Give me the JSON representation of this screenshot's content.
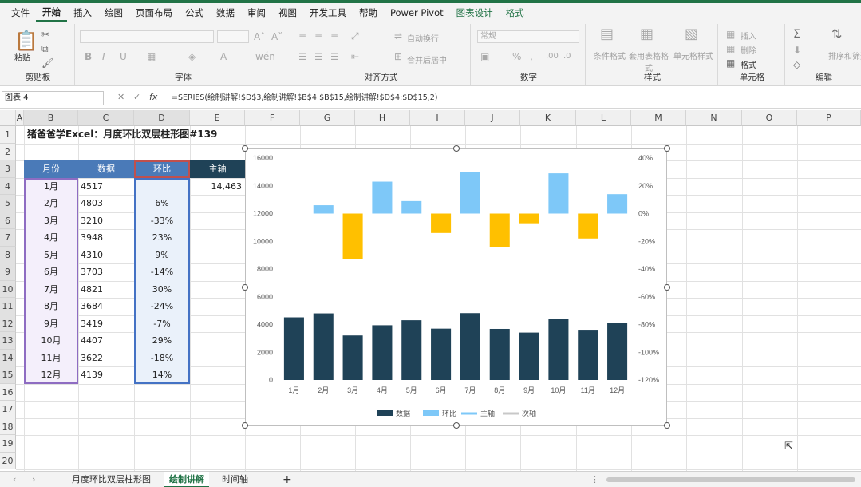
{
  "menu": [
    "文件",
    "开始",
    "插入",
    "绘图",
    "页面布局",
    "公式",
    "数据",
    "审阅",
    "视图",
    "开发工具",
    "帮助",
    "Power Pivot",
    "图表设计",
    "格式"
  ],
  "ribbon": {
    "clipboard": {
      "label": "剪贴板",
      "paste": "粘贴"
    },
    "font": {
      "label": "字体",
      "bold": "B",
      "italic": "I",
      "underline": "U"
    },
    "alignment": {
      "label": "对齐方式",
      "wrap": "自动换行",
      "merge": "合并后居中"
    },
    "number": {
      "label": "数字",
      "format": "常规"
    },
    "styles": {
      "label": "样式",
      "conditional": "条件格式",
      "table": "套用表格格式",
      "cellstyle": "单元格样式"
    },
    "cells": {
      "label": "单元格",
      "insert": "插入",
      "delete": "删除",
      "format": "格式"
    },
    "editing": {
      "label": "编辑",
      "sort": "排序和筛选"
    }
  },
  "formula_bar": {
    "name_box": "图表 4",
    "formula": "=SERIES(绘制讲解!$D$3,绘制讲解!$B$4:$B$15,绘制讲解!$D$4:$D$15,2)"
  },
  "columns": [
    "A",
    "B",
    "C",
    "D",
    "E",
    "F",
    "G",
    "H",
    "I",
    "J",
    "K",
    "L",
    "M",
    "N",
    "O",
    "P"
  ],
  "rows": [
    "1",
    "2",
    "3",
    "4",
    "5",
    "6",
    "7",
    "8",
    "9",
    "10",
    "11",
    "12",
    "13",
    "14",
    "15",
    "16",
    "17",
    "18",
    "19",
    "20"
  ],
  "sheet": {
    "title": "猪爸爸学Excel：月度环比双层柱形图#139",
    "headers": {
      "month": "月份",
      "data": "数据",
      "mom": "环比",
      "main_axis": "主轴"
    },
    "main_axis_value": "14,463",
    "table": [
      {
        "month": "1月",
        "data": "4517",
        "mom": ""
      },
      {
        "month": "2月",
        "data": "4803",
        "mom": "6%"
      },
      {
        "month": "3月",
        "data": "3210",
        "mom": "-33%"
      },
      {
        "month": "4月",
        "data": "3948",
        "mom": "23%"
      },
      {
        "month": "5月",
        "data": "4310",
        "mom": "9%"
      },
      {
        "month": "6月",
        "data": "3703",
        "mom": "-14%"
      },
      {
        "month": "7月",
        "data": "4821",
        "mom": "30%"
      },
      {
        "month": "8月",
        "data": "3684",
        "mom": "-24%"
      },
      {
        "month": "9月",
        "data": "3419",
        "mom": "-7%"
      },
      {
        "month": "10月",
        "data": "4407",
        "mom": "29%"
      },
      {
        "month": "11月",
        "data": "3622",
        "mom": "-18%"
      },
      {
        "month": "12月",
        "data": "4139",
        "mom": "14%"
      }
    ]
  },
  "chart_data": {
    "type": "bar",
    "categories": [
      "1月",
      "2月",
      "3月",
      "4月",
      "5月",
      "6月",
      "7月",
      "8月",
      "9月",
      "10月",
      "11月",
      "12月"
    ],
    "series": [
      {
        "name": "数据",
        "axis": "primary",
        "values": [
          4517,
          4803,
          3210,
          3948,
          4310,
          3703,
          4821,
          3684,
          3419,
          4407,
          3622,
          4139
        ]
      },
      {
        "name": "环比",
        "axis": "secondary",
        "values": [
          null,
          6,
          -33,
          23,
          9,
          -14,
          30,
          -24,
          -7,
          29,
          -18,
          14
        ]
      }
    ],
    "primary_ylim": [
      0,
      16000
    ],
    "primary_ticks": [
      "0",
      "2000",
      "4000",
      "6000",
      "8000",
      "10000",
      "12000",
      "14000",
      "16000"
    ],
    "secondary_ylim": [
      -120,
      40
    ],
    "secondary_ticks": [
      "40%",
      "20%",
      "0%",
      "-20%",
      "-40%",
      "-60%",
      "-80%",
      "-100%",
      "-120%"
    ],
    "legend": [
      "数据",
      "环比",
      "主轴",
      "次轴"
    ],
    "legend_position": "bottom",
    "colors": {
      "data": "#1f4257",
      "mom_pos": "#7ec8f8",
      "mom_neg": "#ffc000",
      "main_axis": "#7ec8f8",
      "sub_axis": "#c8c8c8"
    }
  },
  "tabs": [
    "月度环比双层柱形图",
    "绘制讲解",
    "时间轴"
  ],
  "active_tab": "绘制讲解",
  "colors": {
    "excel_green": "#217346",
    "header_blue": "#4a7ab8",
    "header_dark": "#1f4257"
  }
}
